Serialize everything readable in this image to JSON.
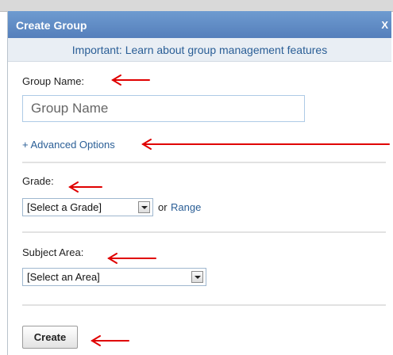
{
  "dialog": {
    "title": "Create Group",
    "close_label": "X"
  },
  "notice": {
    "text": "Important: Learn about group management features"
  },
  "group_name": {
    "label": "Group Name:",
    "placeholder": "Group Name"
  },
  "advanced_options": {
    "label": "+ Advanced Options"
  },
  "grade": {
    "label": "Grade:",
    "selected": "[Select a Grade]",
    "or_text": "or",
    "range_link": "Range"
  },
  "subject_area": {
    "label": "Subject Area:",
    "selected": "[Select an Area]"
  },
  "actions": {
    "create_label": "Create"
  },
  "colors": {
    "titlebar": "#5f8fc7",
    "link": "#2a5e96",
    "annotation_arrow": "#e00000"
  }
}
